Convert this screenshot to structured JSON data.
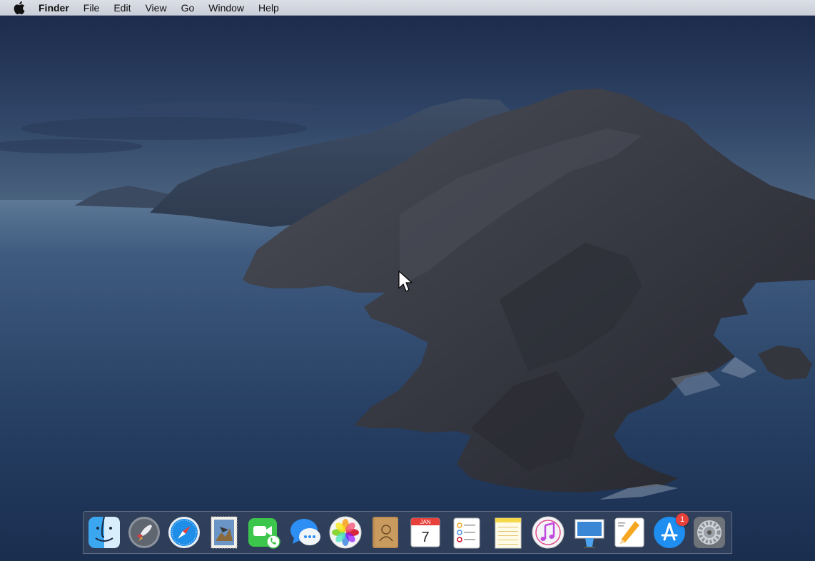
{
  "menubar": {
    "apple_icon": "apple-logo-icon",
    "app_name": "Finder",
    "items": [
      {
        "label": "File"
      },
      {
        "label": "Edit"
      },
      {
        "label": "View"
      },
      {
        "label": "Go"
      },
      {
        "label": "Window"
      },
      {
        "label": "Help"
      }
    ]
  },
  "dock": {
    "items": [
      {
        "name": "finder",
        "icon": "finder-icon"
      },
      {
        "name": "launchpad",
        "icon": "rocket-icon"
      },
      {
        "name": "safari",
        "icon": "compass-icon"
      },
      {
        "name": "mail",
        "icon": "stamp-icon"
      },
      {
        "name": "facetime",
        "icon": "video-camera-icon"
      },
      {
        "name": "messages",
        "icon": "speech-bubble-icon"
      },
      {
        "name": "photos",
        "icon": "flower-icon"
      },
      {
        "name": "contacts",
        "icon": "address-book-icon"
      },
      {
        "name": "calendar",
        "icon": "calendar-icon",
        "month": "JAN",
        "day": "7"
      },
      {
        "name": "reminders",
        "icon": "checklist-icon"
      },
      {
        "name": "notes",
        "icon": "notepad-icon"
      },
      {
        "name": "itunes",
        "icon": "music-note-icon"
      },
      {
        "name": "keynote",
        "icon": "lectern-icon"
      },
      {
        "name": "pages",
        "icon": "pen-icon"
      },
      {
        "name": "app-store",
        "icon": "app-store-icon",
        "badge": "1"
      },
      {
        "name": "system-preferences",
        "icon": "gear-icon"
      }
    ]
  },
  "colors": {
    "sky_top": "#1a2848",
    "sea": "#2e4a6e",
    "rock": "#3a3c44",
    "badge": "#e8403a"
  }
}
